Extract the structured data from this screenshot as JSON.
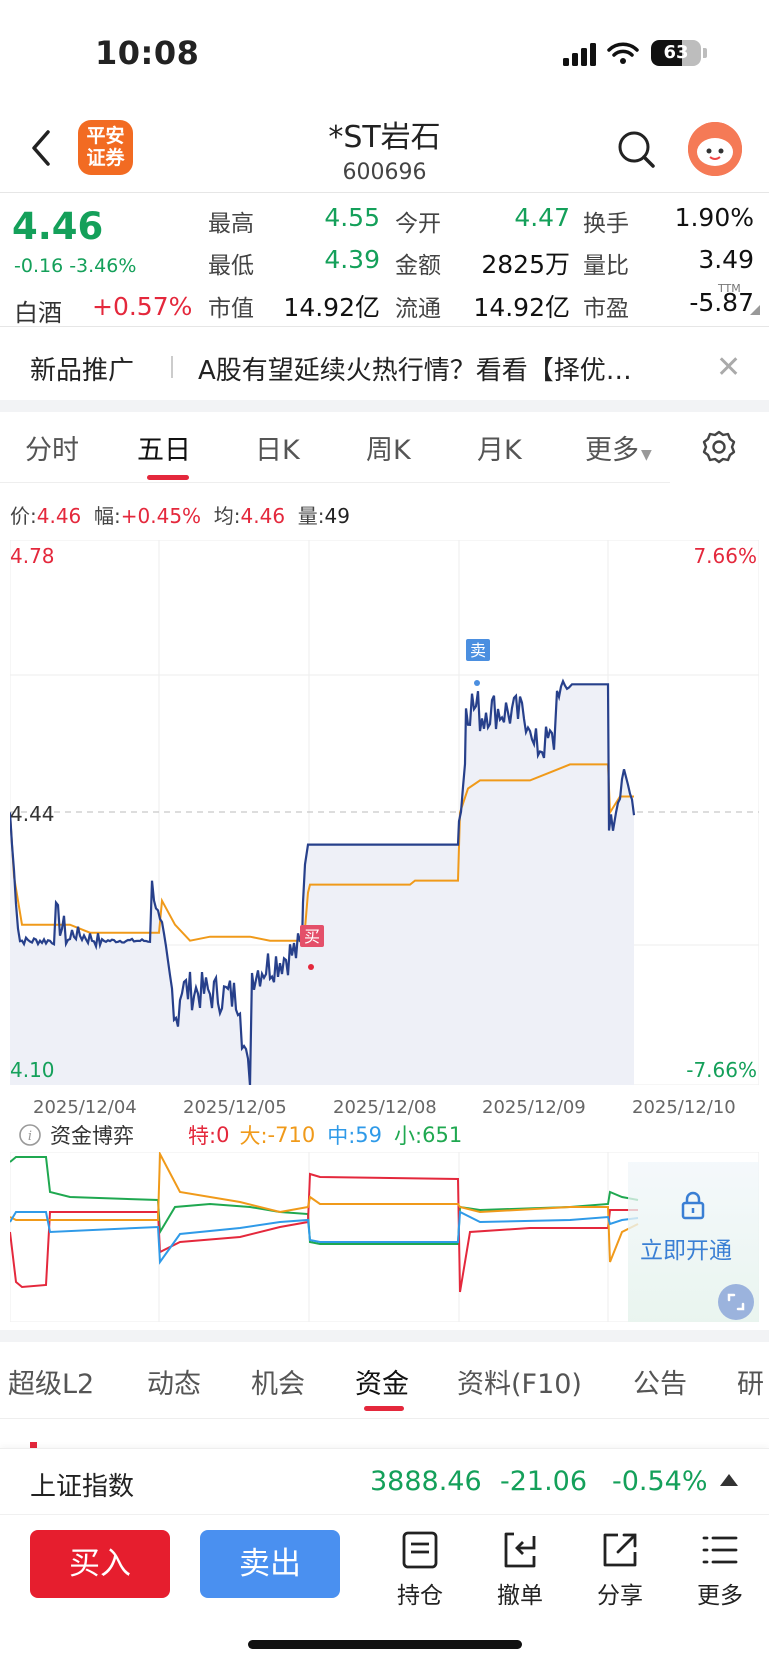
{
  "status_bar": {
    "time": "10:08",
    "battery": "63"
  },
  "header": {
    "logo_text": "平安证券",
    "title": "*ST岩石",
    "code": "600696"
  },
  "quote": {
    "price": "4.46",
    "change": "-0.16  -3.46%",
    "sector_name": "白酒",
    "sector_change": "+0.57%",
    "fields": [
      {
        "label": "最高",
        "value": "4.55",
        "color": "green"
      },
      {
        "label": "今开",
        "value": "4.47",
        "color": "green"
      },
      {
        "label": "换手",
        "value": "1.90%",
        "color": "black"
      },
      {
        "label": "最低",
        "value": "4.39",
        "color": "green"
      },
      {
        "label": "金额",
        "value": "2825万",
        "color": "black"
      },
      {
        "label": "量比",
        "value": "3.49",
        "color": "black"
      },
      {
        "label": "市值",
        "value": "14.92亿",
        "color": "black"
      },
      {
        "label": "流通",
        "value": "14.92亿",
        "color": "black"
      },
      {
        "label": "市盈",
        "value": "-5.87",
        "color": "black"
      }
    ],
    "ttm": "TTM"
  },
  "promo": {
    "label": "新品推广",
    "text": "A股有望延续火热行情？看看【择优…",
    "close": "✕"
  },
  "chart_tabs": [
    "分时",
    "五日",
    "日K",
    "周K",
    "月K",
    "更多"
  ],
  "active_tab": "五日",
  "info_line": {
    "price_label": "价:",
    "price": "4.46",
    "amp_label": "幅:",
    "amp": "+0.45%",
    "avg_label": "均:",
    "avg": "4.46",
    "vol_label": "量:",
    "vol": "49"
  },
  "chart_data": {
    "type": "line",
    "y_axis": {
      "top": "4.78",
      "mid": "4.44",
      "bottom": "4.10"
    },
    "pct_axis": {
      "top": "7.66%",
      "bottom": "-7.66%"
    },
    "dates": [
      "2025/12/04",
      "2025/12/05",
      "2025/12/08",
      "2025/12/09",
      "2025/12/10"
    ],
    "ylim": [
      4.1,
      4.78
    ],
    "markers": {
      "buy": "买",
      "sell": "卖"
    },
    "colors": {
      "price": "#27408b",
      "avg": "#f09a1a",
      "fill": "#eef0f7"
    }
  },
  "fund_flow": {
    "title": "资金博弈",
    "special_label": "特:",
    "special": "0",
    "large_label": "大:",
    "large": "-710",
    "mid_label": "中:",
    "mid": "59",
    "small_label": "小:",
    "small": "651",
    "unlock": "立即开通"
  },
  "sub_tabs": [
    "超级L2",
    "动态",
    "机会",
    "资金",
    "资料(F10)",
    "公告",
    "研"
  ],
  "active_sub_tab": "资金",
  "index": {
    "name": "上证指数",
    "value": "3888.46",
    "change": "-21.06",
    "pct": "-0.54%"
  },
  "bottom": {
    "buy": "买入",
    "sell": "卖出",
    "items": [
      "持仓",
      "撤单",
      "分享",
      "更多"
    ]
  }
}
